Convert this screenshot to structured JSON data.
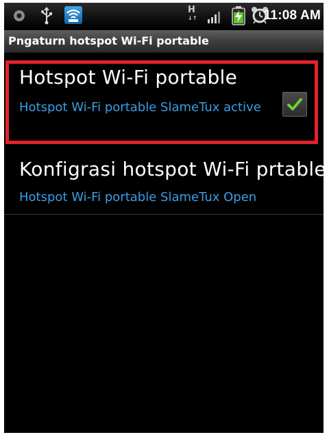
{
  "status_bar": {
    "time": "11:08 AM",
    "network_type": "H",
    "icons": [
      "notification-dot-icon",
      "usb-icon",
      "wifi-hotspot-icon",
      "hspa-icon",
      "signal-icon",
      "battery-charging-icon",
      "alarm-icon"
    ]
  },
  "title_bar": {
    "title": "Pngaturn hotspot Wi-Fi portable"
  },
  "preferences": [
    {
      "title": "Hotspot Wi-Fi portable",
      "summary": "Hotspot Wi-Fi portable SlameTux active",
      "checked": true
    },
    {
      "title": "Konfigrasi hotspot Wi-Fi prtable",
      "summary": "Hotspot Wi-Fi portable SlameTux Open"
    }
  ],
  "colors": {
    "background": "#000000",
    "summary_text": "#3a9ee6",
    "highlight": "#e3222c",
    "checkmark": "#6fd12e"
  }
}
